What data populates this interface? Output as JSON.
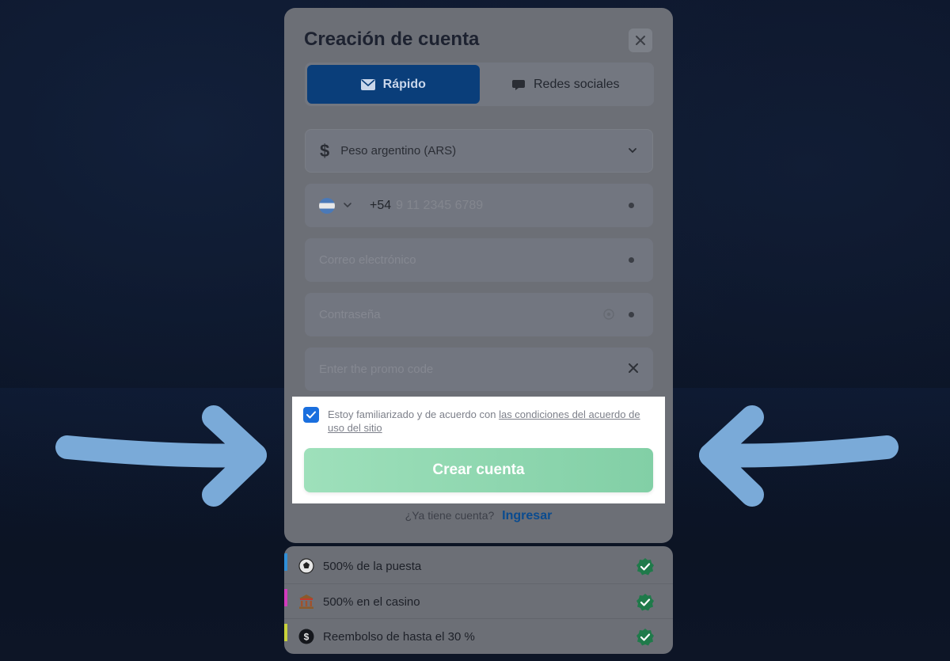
{
  "modal": {
    "title": "Creación de cuenta",
    "close_icon": "close-icon",
    "tabs": [
      {
        "label": "Rápido",
        "icon": "envelope-icon",
        "active": true
      },
      {
        "label": "Redes sociales",
        "icon": "chat-bubble-icon",
        "active": false
      }
    ],
    "currency": {
      "value": "Peso argentino (ARS)",
      "icon": "dollar-icon"
    },
    "phone": {
      "country_code": "+54",
      "placeholder": "9 11 2345 6789",
      "flag": "argentina-flag-icon"
    },
    "email": {
      "placeholder": "Correo electrónico"
    },
    "password": {
      "placeholder": "Contraseña"
    },
    "promo": {
      "placeholder": "Enter the promo code"
    },
    "agreement": {
      "text": "Estoy familiarizado y de acuerdo con",
      "link_text": "las condiciones del acuerdo de uso del sitio",
      "checked": true
    },
    "submit_label": "Crear cuenta",
    "login": {
      "question": "¿Ya tiene cuenta?",
      "link": "Ingresar"
    }
  },
  "bonuses": [
    {
      "label": "500% de la puesta",
      "icon": "soccer-ball-icon",
      "color": "#2f8fd8"
    },
    {
      "label": "500% en el casino",
      "icon": "casino-icon",
      "color": "#d23bbd"
    },
    {
      "label": "Reembolso de hasta el 30 %",
      "icon": "cashback-icon",
      "color": "#c9d23a"
    }
  ],
  "colors": {
    "accent_blue": "#0a3e7a",
    "submit_green": "#9ee0bb",
    "arrow_blue": "#7aaad8",
    "check_green": "#1f7a4a"
  }
}
